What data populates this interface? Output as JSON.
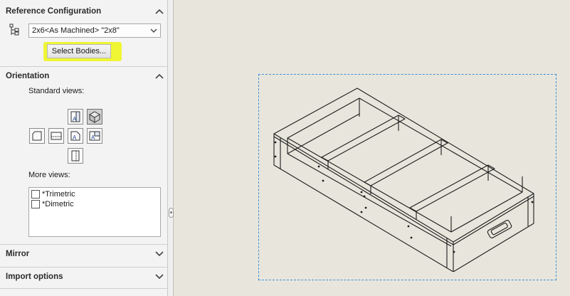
{
  "reference_configuration": {
    "title": "Reference Configuration",
    "selected_value": "2x6<As Machined> \"2x8\"",
    "select_bodies_label": "Select Bodies..."
  },
  "orientation": {
    "title": "Orientation",
    "standard_views_label": "Standard views:",
    "more_views_label": "More views:",
    "more_views": [
      {
        "label": "*Trimetric",
        "checked": false
      },
      {
        "label": "*Dimetric",
        "checked": false
      }
    ]
  },
  "mirror": {
    "title": "Mirror"
  },
  "import_options": {
    "title": "Import options"
  },
  "colors": {
    "highlight": "#f0f534",
    "selection_border": "#3f8fd8",
    "viewport_bg": "#e8e6dc"
  }
}
